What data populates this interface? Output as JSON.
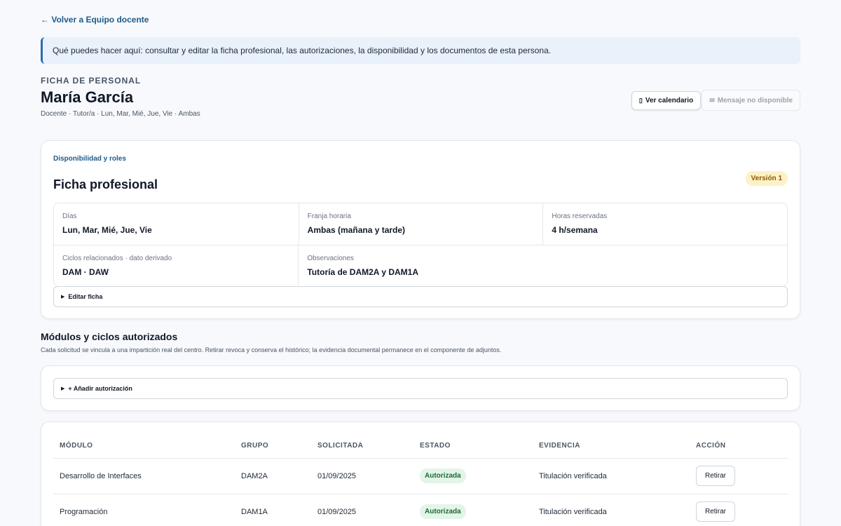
{
  "nav": {
    "back_label": "← Volver a Equipo docente"
  },
  "banner": {
    "text": "Qué puedes hacer aquí: consultar y editar la ficha profesional, las autorizaciones, la disponibilidad y los documentos de esta persona."
  },
  "header": {
    "eyebrow": "FICHA DE PERSONAL",
    "name": "María García",
    "meta": "Docente · Tutor/a · Lun, Mar, Mié, Jue, Vie · Ambas",
    "calendar_button": {
      "icon": "calendar-icon",
      "label": "Ver calendario"
    },
    "message_button": {
      "icon": "mail-icon",
      "label": "Mensaje no disponible"
    }
  },
  "profile_card": {
    "section_label": "Disponibilidad y roles",
    "title": "Ficha profesional",
    "version": "Versión 1",
    "fields": {
      "dias": {
        "label": "Días",
        "value": "Lun, Mar, Mié, Jue, Vie"
      },
      "franja": {
        "label": "Franja horaria",
        "value": "Ambas (mañana y tarde)"
      },
      "horas": {
        "label": "Horas reservadas",
        "value": "4 h/semana"
      },
      "ciclos": {
        "label": "Ciclos relacionados · dato derivado",
        "value": "DAM · DAW"
      },
      "observaciones": {
        "label": "Observaciones",
        "value": "Tutoría de DAM2A y DAM1A"
      }
    },
    "edit_label": "Editar ficha"
  },
  "authorizations": {
    "title": "Módulos y ciclos autorizados",
    "description": "Cada solicitud se vincula a una impartición real del centro. Retirar revoca y conserva el histórico; la evidencia documental permanece en el componente de adjuntos.",
    "add_label": "+ Añadir autorización",
    "columns": [
      "MÓDULO",
      "GRUPO",
      "SOLICITADA",
      "ESTADO",
      "EVIDENCIA",
      "ACCIÓN"
    ],
    "rows": [
      {
        "modulo": "Desarrollo de Interfaces",
        "grupo": "DAM2A",
        "solicitada": "01/09/2025",
        "estado": "Autorizada",
        "evidencia": "Titulación verificada",
        "accion": "Retirar"
      },
      {
        "modulo": "Programación",
        "grupo": "DAM1A",
        "solicitada": "01/09/2025",
        "estado": "Autorizada",
        "evidencia": "Titulación verificada",
        "accion": "Retirar"
      }
    ]
  },
  "colors": {
    "accent": "#1e5a8a",
    "banner_bg": "#e9f1fb",
    "version_badge_bg": "#fdf1c7",
    "status_authorized_bg": "#e3f4e8",
    "status_authorized_text": "#1b6b36"
  }
}
